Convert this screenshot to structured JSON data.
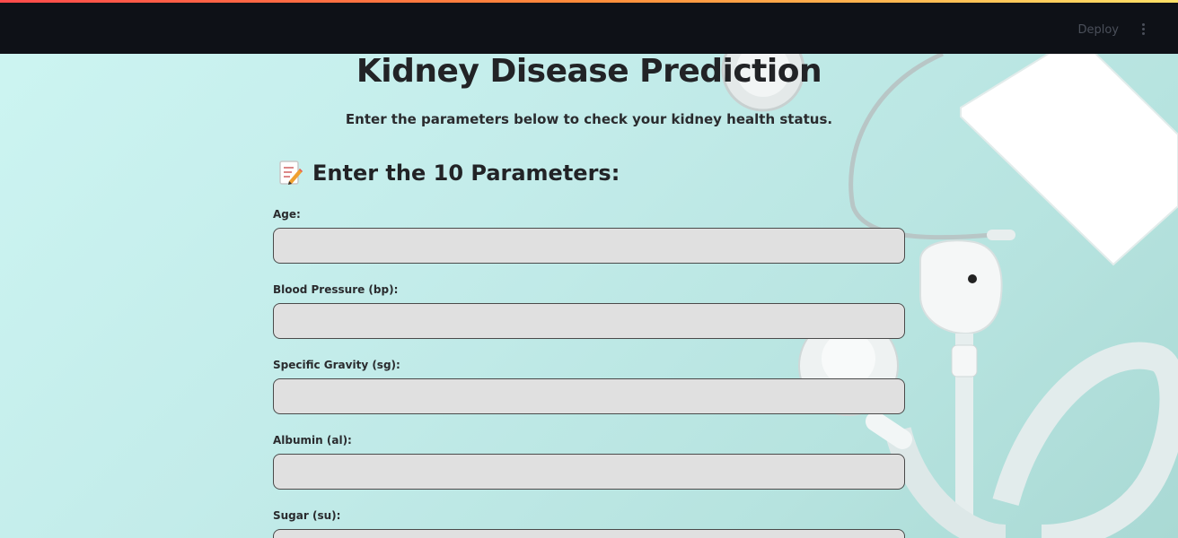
{
  "header": {
    "deploy_label": "Deploy"
  },
  "main": {
    "title": "Kidney Disease Prediction",
    "subtitle": "Enter the parameters below to check your kidney health status.",
    "section_heading": "Enter the 10 Parameters:",
    "section_icon": "memo-icon",
    "fields": [
      {
        "label": "Age:",
        "value": ""
      },
      {
        "label": "Blood Pressure (bp):",
        "value": ""
      },
      {
        "label": "Specific Gravity (sg):",
        "value": ""
      },
      {
        "label": "Albumin (al):",
        "value": ""
      },
      {
        "label": "Sugar (su):",
        "value": ""
      }
    ]
  },
  "colors": {
    "header_bg": "#0e1117",
    "input_bg": "#e0e0e0",
    "background": "#c9ede8"
  }
}
